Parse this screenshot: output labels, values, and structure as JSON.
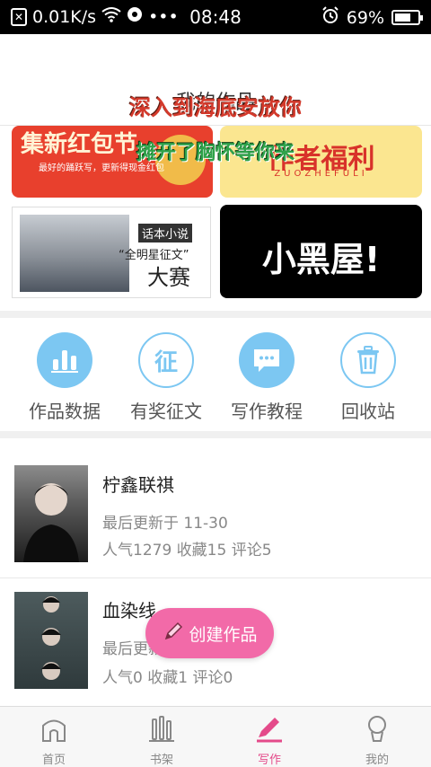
{
  "status_bar": {
    "network_speed": "0.01K/s",
    "time": "08:48",
    "battery_percent": "69%",
    "battery_level": 0.69
  },
  "header": {
    "title": "我的作品"
  },
  "overlay_texts": [
    "深入到海底安放你",
    "摊开了胸怀等你来"
  ],
  "banners": {
    "red_packet": {
      "title": "集新红包节",
      "small": "最好的踊跃写，更新得现金红包"
    },
    "author_welfare": {
      "title": "作者福利",
      "small": "ZUOZHEFULI"
    },
    "contest": {
      "tag": "话本小说",
      "subtitle": "“全明星征文”",
      "title": "大赛"
    },
    "black_room": {
      "title": "小黑屋!"
    }
  },
  "tools": [
    {
      "label": "作品数据",
      "icon": "bar-chart-icon"
    },
    {
      "label": "有奖征文",
      "icon": "contest-icon",
      "glyph": "征"
    },
    {
      "label": "写作教程",
      "icon": "chat-icon"
    },
    {
      "label": "回收站",
      "icon": "trash-icon"
    }
  ],
  "works": [
    {
      "name": "柠鑫联祺",
      "updated": "最后更新于 11-30",
      "stats": "人气1279 收藏15 评论5"
    },
    {
      "name": "血染线",
      "updated": "最后更新于 11-30",
      "stats": "人气0 收藏1 评论0"
    }
  ],
  "fab": {
    "label": "创建作品"
  },
  "bottom_nav": [
    {
      "label": "首页",
      "icon": "home-icon"
    },
    {
      "label": "书架",
      "icon": "bookshelf-icon"
    },
    {
      "label": "写作",
      "icon": "pen-icon",
      "active": true
    },
    {
      "label": "我的",
      "icon": "profile-icon"
    }
  ],
  "colors": {
    "accent": "#f26aa8",
    "icon_blue": "#7cc7f2",
    "active_nav": "#e44a8a"
  }
}
